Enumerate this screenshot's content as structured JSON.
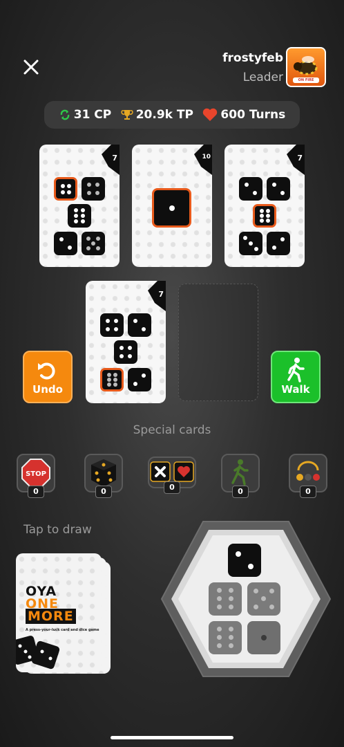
{
  "header": {
    "username": "frostyfeb",
    "rank": "Leader",
    "avatar_badge": "ON FIRE"
  },
  "stats": {
    "cp": "31 CP",
    "tp": "20.9k TP",
    "turns": "600 Turns"
  },
  "cards": [
    {
      "value": "7"
    },
    {
      "value": "10"
    },
    {
      "value": "7"
    },
    {
      "value": "7"
    }
  ],
  "buttons": {
    "undo": "Undo",
    "walk": "Walk"
  },
  "special": {
    "title": "Special cards",
    "items": [
      {
        "icon": "stop-sign-icon",
        "count": "0"
      },
      {
        "icon": "die-icon",
        "count": "0"
      },
      {
        "icon": "cross-heart-icon",
        "count": "0"
      },
      {
        "icon": "walking-figure-icon",
        "count": "0"
      },
      {
        "icon": "dice-trio-icon",
        "count": "0"
      }
    ]
  },
  "draw": {
    "tap_label": "Tap to draw",
    "logo_line1": "OYA",
    "logo_line2": "ONE",
    "logo_line3": "MORE",
    "tagline": "A press-your-luck card and dice game"
  },
  "colors": {
    "accent_orange": "#f5890e",
    "accent_green": "#1bc02a",
    "highlight": "#e85a1b",
    "heart": "#e8452c"
  }
}
